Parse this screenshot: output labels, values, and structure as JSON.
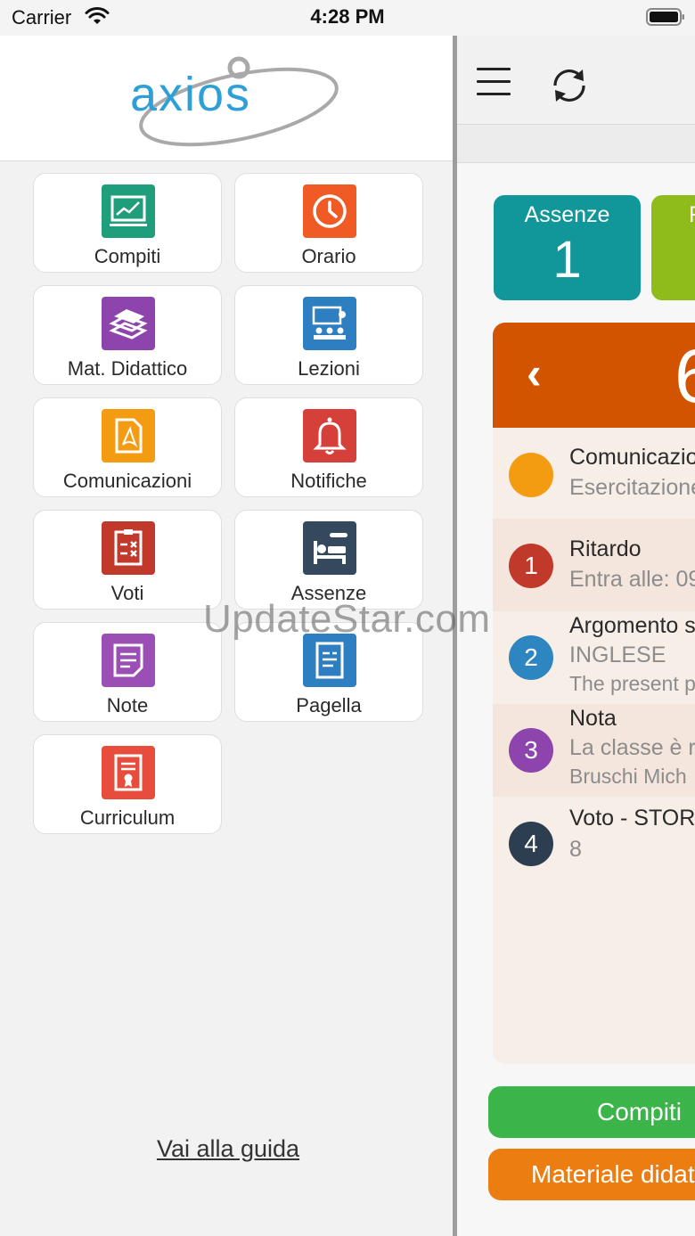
{
  "status_bar": {
    "carrier": "Carrier",
    "time": "4:28 PM"
  },
  "drawer": {
    "logo_text": "axios",
    "tiles": [
      {
        "label": "Compiti",
        "icon": "whiteboard-chart-icon",
        "color": "#1e9e7b"
      },
      {
        "label": "Orario",
        "icon": "clock-icon",
        "color": "#f05a24"
      },
      {
        "label": "Mat. Didattico",
        "icon": "books-icon",
        "color": "#8e44ad"
      },
      {
        "label": "Lezioni",
        "icon": "classroom-icon",
        "color": "#2e7fc1"
      },
      {
        "label": "Comunicazioni",
        "icon": "pdf-document-icon",
        "color": "#f39c12"
      },
      {
        "label": "Notifiche",
        "icon": "bell-icon",
        "color": "#d6403a"
      },
      {
        "label": "Voti",
        "icon": "grades-clipboard-icon",
        "color": "#c0392b"
      },
      {
        "label": "Assenze",
        "icon": "bed-thermometer-icon",
        "color": "#34495e"
      },
      {
        "label": "Note",
        "icon": "note-icon",
        "color": "#9b4fb5"
      },
      {
        "label": "Pagella",
        "icon": "report-card-icon",
        "color": "#2e7fc1"
      },
      {
        "label": "Curriculum",
        "icon": "certificate-icon",
        "color": "#e74c3c"
      }
    ],
    "guide_link": "Vai alla guida"
  },
  "main": {
    "stats": [
      {
        "title": "Assenze",
        "value": "1",
        "color": "#11969a"
      },
      {
        "title": "R",
        "value": "",
        "color": "#8fbc1a"
      }
    ],
    "day": {
      "prev_symbol": "‹",
      "day_number": "6",
      "header_color": "#d35400",
      "events": [
        {
          "badge": "",
          "badge_color": "#f39c12",
          "title": "Comunicazioni",
          "subtitle": "Esercitazione",
          "detail": ""
        },
        {
          "badge": "1",
          "badge_color": "#c0392b",
          "title": "Ritardo",
          "subtitle": "Entra alle: 09",
          "detail": ""
        },
        {
          "badge": "2",
          "badge_color": "#2e86c1",
          "title": "Argomento s",
          "subtitle": "INGLESE",
          "detail": "The present p"
        },
        {
          "badge": "3",
          "badge_color": "#8e44ad",
          "title": "Nota",
          "subtitle": "La classe è r",
          "detail": "Bruschi Mich"
        },
        {
          "badge": "4",
          "badge_color": "#2c3e50",
          "title": "Voto - STOR",
          "subtitle": "8",
          "detail": ""
        }
      ]
    },
    "buttons": {
      "compiti": "Compiti",
      "materiale": "Materiale didattico"
    }
  },
  "watermark": "UpdateStar.com"
}
